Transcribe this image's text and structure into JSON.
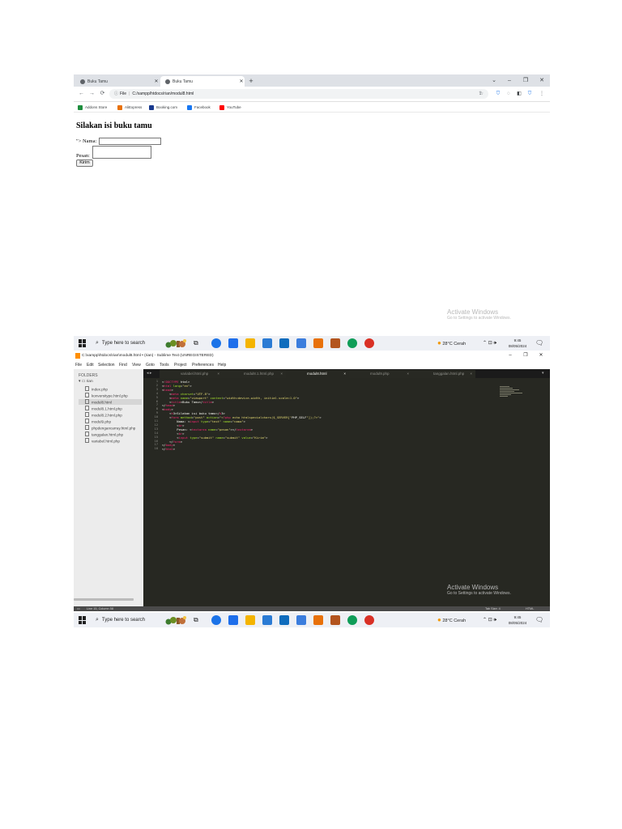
{
  "browser": {
    "tabs": [
      {
        "title": "Buku Tamu",
        "active": false
      },
      {
        "title": "Buku Tamu",
        "active": true
      }
    ],
    "url": "C:/xampp/htdocs/rian/modul8.html",
    "url_prefix": "File",
    "bookmarks": [
      "Addons Store",
      "AliExpress",
      "Booking.com",
      "Facebook",
      "YouTube"
    ],
    "bookmark_colors": [
      "#1e8e3e",
      "#e8710a",
      "#1a3a8f",
      "#1877f2",
      "#ff0000"
    ],
    "page": {
      "heading": "Silakan isi buku tamu",
      "name_label": "\"> Nama:",
      "message_label": "Pesan:",
      "submit_label": "Kirim"
    }
  },
  "watermark": {
    "title": "Activate Windows",
    "subtitle": "Go to Settings to activate Windows."
  },
  "taskbar": {
    "search_placeholder": "Type here to search",
    "weather": "28°C  Cerah",
    "time": "9:45",
    "date": "08/05/2024",
    "app_colors": [
      "#1b73e8",
      "#1f6feb",
      "#f4b400",
      "#2b7bd4",
      "#0f6cbd",
      "#3b7ddd",
      "#e8710a",
      "#b3541e",
      "#0f9d58",
      "#d93025"
    ]
  },
  "sublime": {
    "title": "C:\\xampp\\htdocs\\rian\\modul8.html • (rian) - Sublime Text (UNREGISTERED)",
    "menu": [
      "File",
      "Edit",
      "Selection",
      "Find",
      "View",
      "Goto",
      "Tools",
      "Project",
      "Preferences",
      "Help"
    ],
    "sidebar": {
      "header": "FOLDERS",
      "root": "rian",
      "files": [
        "index.php",
        "konversitype.html.php",
        "modul8.html",
        "modul8.1.html.php",
        "modul8.2.html.php",
        "modul9.php",
        "phpdengancarray.html.php",
        "tanggalan.html.php",
        "variabel.html.php"
      ],
      "current": "modul8.html"
    },
    "tabs": [
      "variabel.html.php",
      "modul8.1.html.php",
      "modul8.html",
      "modul9.php",
      "tanggalan.html.php"
    ],
    "active_tab": "modul8.html",
    "code_lines": [
      "<!DOCTYPE html>",
      "<html lang=\"en\">",
      "<head>",
      "    <meta charset=\"UTF-8\">",
      "    <meta name=\"viewport\" content=\"width=device-width, initial-scale=1.0\">",
      "    <title>Buku Tamu</title>",
      "</head>",
      "<body>",
      "    <h3>Silakan isi buku tamu</h3>",
      "    <form method=\"post\" action=\"<?php echo htmlspecialchars($_SERVER[\"PHP_SELF\"]);?>\">",
      "        Nama: <input type=\"text\" name=\"nama\">",
      "        <br>",
      "        Pesan: <textarea name=\"pesan\"></textarea>",
      "        <br>",
      "        <input type=\"submit\" name=\"submit\" value=\"Kirim\">",
      "    </form>",
      "</body>",
      "</html>"
    ],
    "status_left": "Line 15, Column 58",
    "status_tab": "Tab Size: 4",
    "status_syntax": "HTML"
  }
}
